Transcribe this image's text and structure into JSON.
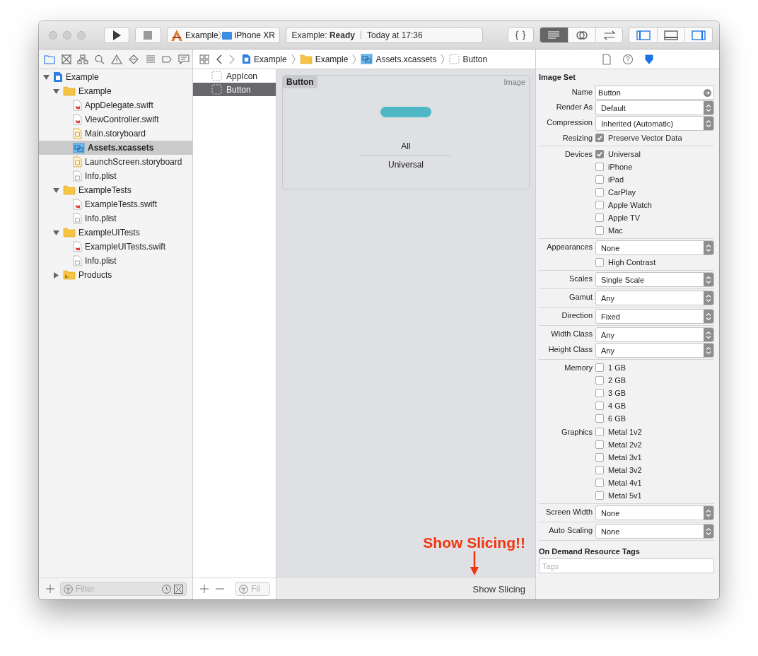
{
  "toolbar": {
    "scheme": "Example",
    "device": "iPhone XR",
    "status_project": "Example:",
    "status_state": "Ready",
    "status_time": "Today at 17:36",
    "editor_modes": [
      {
        "kind": "standard",
        "selected": true
      },
      {
        "kind": "assistant",
        "selected": false
      },
      {
        "kind": "version",
        "selected": false
      }
    ],
    "panels": [
      {
        "kind": "navigator",
        "on": true
      },
      {
        "kind": "debug",
        "on": false
      },
      {
        "kind": "inspector",
        "on": true
      }
    ]
  },
  "navigator_tabs": [
    {
      "kind": "project",
      "selected": true
    },
    {
      "kind": "source",
      "selected": false
    },
    {
      "kind": "symbol",
      "selected": false
    },
    {
      "kind": "find",
      "selected": false
    },
    {
      "kind": "issue",
      "selected": false
    },
    {
      "kind": "test",
      "selected": false
    },
    {
      "kind": "debug",
      "selected": false
    },
    {
      "kind": "breakpoint",
      "selected": false
    },
    {
      "kind": "report",
      "selected": false
    }
  ],
  "breadcrumbs": [
    {
      "kind": "project",
      "label": "Example"
    },
    {
      "kind": "folder",
      "label": "Example"
    },
    {
      "kind": "assets",
      "label": "Assets.xcassets"
    },
    {
      "kind": "imageset",
      "label": "Button"
    }
  ],
  "inspector_tabs": [
    {
      "kind": "file",
      "selected": false
    },
    {
      "kind": "help",
      "selected": false
    },
    {
      "kind": "attributes",
      "selected": true
    }
  ],
  "tree": [
    {
      "kind": "project",
      "label": "Example",
      "expanded": true,
      "selected": false,
      "children": [
        {
          "kind": "folder",
          "label": "Example",
          "expanded": true,
          "selected": false,
          "children": [
            {
              "kind": "swift",
              "label": "AppDelegate.swift",
              "selected": false
            },
            {
              "kind": "swift",
              "label": "ViewController.swift",
              "selected": false
            },
            {
              "kind": "storyboard",
              "label": "Main.storyboard",
              "selected": false
            },
            {
              "kind": "assets",
              "label": "Assets.xcassets",
              "selected": true
            },
            {
              "kind": "storyboard",
              "label": "LaunchScreen.storyboard",
              "selected": false
            },
            {
              "kind": "plist",
              "label": "Info.plist",
              "selected": false
            }
          ]
        },
        {
          "kind": "folder",
          "label": "ExampleTests",
          "expanded": true,
          "selected": false,
          "children": [
            {
              "kind": "swift",
              "label": "ExampleTests.swift",
              "selected": false
            },
            {
              "kind": "plist",
              "label": "Info.plist",
              "selected": false
            }
          ]
        },
        {
          "kind": "folder",
          "label": "ExampleUITests",
          "expanded": true,
          "selected": false,
          "children": [
            {
              "kind": "swift",
              "label": "ExampleUITests.swift",
              "selected": false
            },
            {
              "kind": "plist",
              "label": "Info.plist",
              "selected": false
            }
          ]
        },
        {
          "kind": "products",
          "label": "Products",
          "expanded": false,
          "selected": false
        }
      ]
    }
  ],
  "navigator_filter": {
    "placeholder": "Filter"
  },
  "asset_list": [
    {
      "label": "AppIcon",
      "selected": false
    },
    {
      "label": "Button",
      "selected": true
    }
  ],
  "asset_filter": {
    "placeholder": "Fil"
  },
  "asset_card": {
    "title": "Button",
    "type": "Image",
    "slot_label": "All",
    "slot_device": "Universal"
  },
  "annotation": "Show Slicing!!",
  "show_slicing": "Show Slicing",
  "inspector": {
    "title": "Image Set",
    "groups": [
      [
        {
          "kind": "field",
          "label": "Name",
          "value": "Button"
        },
        {
          "kind": "select",
          "label": "Render As",
          "value": "Default"
        },
        {
          "kind": "select",
          "label": "Compression",
          "value": "Inherited (Automatic)"
        },
        {
          "kind": "checks",
          "label": "Resizing",
          "options": [
            {
              "label": "Preserve Vector Data",
              "checked": true
            }
          ]
        }
      ],
      [
        {
          "kind": "checks",
          "label": "Devices",
          "options": [
            {
              "label": "Universal",
              "checked": true
            },
            {
              "label": "iPhone",
              "checked": false
            },
            {
              "label": "iPad",
              "checked": false
            },
            {
              "label": "CarPlay",
              "checked": false
            },
            {
              "label": "Apple Watch",
              "checked": false
            },
            {
              "label": "Apple TV",
              "checked": false
            },
            {
              "label": "Mac",
              "checked": false
            }
          ]
        }
      ],
      [
        {
          "kind": "select",
          "label": "Appearances",
          "value": "None"
        },
        {
          "kind": "checks",
          "options": [
            {
              "label": "High Contrast",
              "checked": false
            }
          ]
        }
      ],
      [
        {
          "kind": "select",
          "label": "Scales",
          "value": "Single Scale"
        }
      ],
      [
        {
          "kind": "select",
          "label": "Gamut",
          "value": "Any"
        }
      ],
      [
        {
          "kind": "select",
          "label": "Direction",
          "value": "Fixed"
        }
      ],
      [
        {
          "kind": "select",
          "label": "Width Class",
          "value": "Any"
        },
        {
          "kind": "select",
          "label": "Height Class",
          "value": "Any"
        }
      ],
      [
        {
          "kind": "checks",
          "label": "Memory",
          "options": [
            {
              "label": "1 GB",
              "checked": false
            },
            {
              "label": "2 GB",
              "checked": false
            },
            {
              "label": "3 GB",
              "checked": false
            },
            {
              "label": "4 GB",
              "checked": false
            },
            {
              "label": "6 GB",
              "checked": false
            }
          ]
        },
        {
          "kind": "checks",
          "label": "Graphics",
          "options": [
            {
              "label": "Metal 1v2",
              "checked": false
            },
            {
              "label": "Metal 2v2",
              "checked": false
            },
            {
              "label": "Metal 3v1",
              "checked": false
            },
            {
              "label": "Metal 3v2",
              "checked": false
            },
            {
              "label": "Metal 4v1",
              "checked": false
            },
            {
              "label": "Metal 5v1",
              "checked": false
            }
          ]
        }
      ],
      [
        {
          "kind": "select",
          "label": "Screen Width",
          "value": "None"
        }
      ],
      [
        {
          "kind": "select",
          "label": "Auto Scaling",
          "value": "None"
        }
      ]
    ],
    "tags_title": "On Demand Resource Tags",
    "tags_placeholder": "Tags"
  }
}
